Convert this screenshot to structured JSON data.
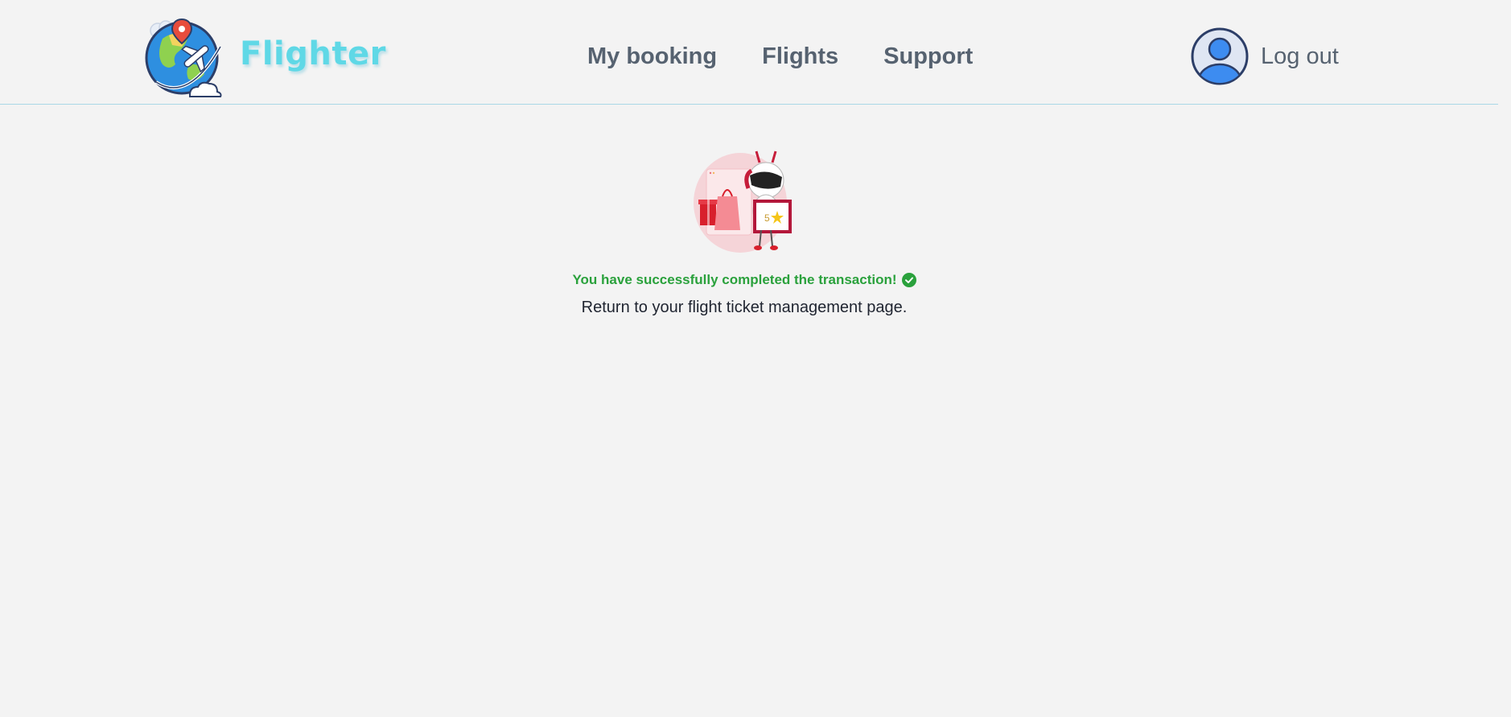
{
  "header": {
    "brand": "Flighter",
    "nav": [
      {
        "label": "My booking"
      },
      {
        "label": "Flights"
      },
      {
        "label": "Support"
      }
    ],
    "logout_label": "Log out"
  },
  "main": {
    "success_message": "You have successfully completed the transaction!",
    "return_message": "Return to your flight ticket management page.",
    "illustration_rating_text": "5"
  },
  "colors": {
    "accent_brand": "#5fd8e6",
    "success": "#2aa13c",
    "nav_text": "#566270",
    "header_border": "#a9d8e6",
    "background": "#f3f3f3"
  },
  "icons": [
    "globe-plane-logo-icon",
    "user-avatar-icon",
    "check-circle-icon"
  ]
}
